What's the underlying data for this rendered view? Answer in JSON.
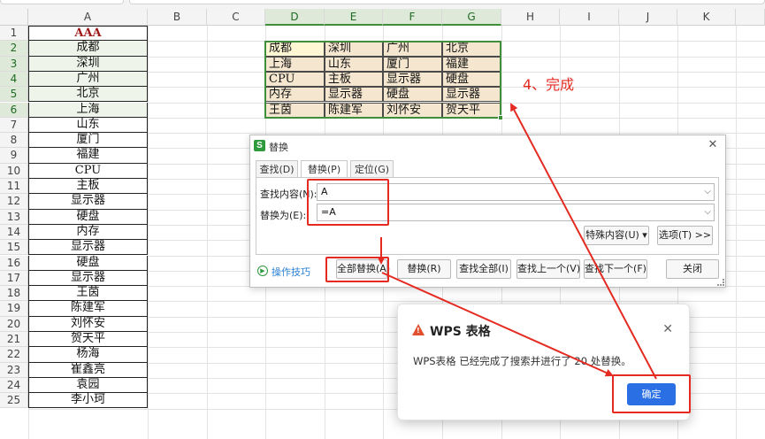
{
  "columns": [
    "A",
    "B",
    "C",
    "D",
    "E",
    "F",
    "G",
    "H",
    "I",
    "J",
    "K"
  ],
  "rows": [
    "1",
    "2",
    "3",
    "4",
    "5",
    "6",
    "7",
    "8",
    "9",
    "10",
    "11",
    "12",
    "13",
    "14",
    "15",
    "16",
    "17",
    "18",
    "19",
    "20",
    "21",
    "22",
    "23",
    "24",
    "25"
  ],
  "column_a": [
    "AAA",
    "成都",
    "深圳",
    "广州",
    "北京",
    "上海",
    "山东",
    "厦门",
    "福建",
    "CPU",
    "主板",
    "显示器",
    "硬盘",
    "内存",
    "显示器",
    "硬盘",
    "显示器",
    "王茵",
    "陈建军",
    "刘怀安",
    "贺天平",
    "杨海",
    "崔鑫亮",
    "袁园",
    "李小珂"
  ],
  "range_dg": [
    [
      "成都",
      "深圳",
      "广州",
      "北京"
    ],
    [
      "上海",
      "山东",
      "厦门",
      "福建"
    ],
    [
      "CPU",
      "主板",
      "显示器",
      "硬盘"
    ],
    [
      "内存",
      "显示器",
      "硬盘",
      "显示器"
    ],
    [
      "王茵",
      "陈建军",
      "刘怀安",
      "贺天平"
    ]
  ],
  "annotation": "4、完成",
  "replace_dialog": {
    "title": "替换",
    "tabs": [
      "查找(D)",
      "替换(P)",
      "定位(G)"
    ],
    "active_tab": 1,
    "find_label": "查找内容(N):",
    "find_value": "A",
    "replace_label": "替换为(E):",
    "replace_value": "=A",
    "special_button": "特殊内容(U) ▾",
    "options_button": "选项(T) >>",
    "tips_label": "操作技巧",
    "buttons": [
      "全部替换(A)",
      "替换(R)",
      "查找全部(I)",
      "查找上一个(V)",
      "查找下一个(F)",
      "关闭"
    ]
  },
  "message_box": {
    "title": "WPS 表格",
    "text": "WPS表格 已经完成了搜索并进行了 20 处替换。",
    "ok_button": "确定"
  },
  "colors": {
    "accent_green": "#3f8f3a",
    "annotation_red": "#e52a22",
    "range_fill": "#f5e7cf",
    "ok_blue": "#2a6fe3"
  }
}
